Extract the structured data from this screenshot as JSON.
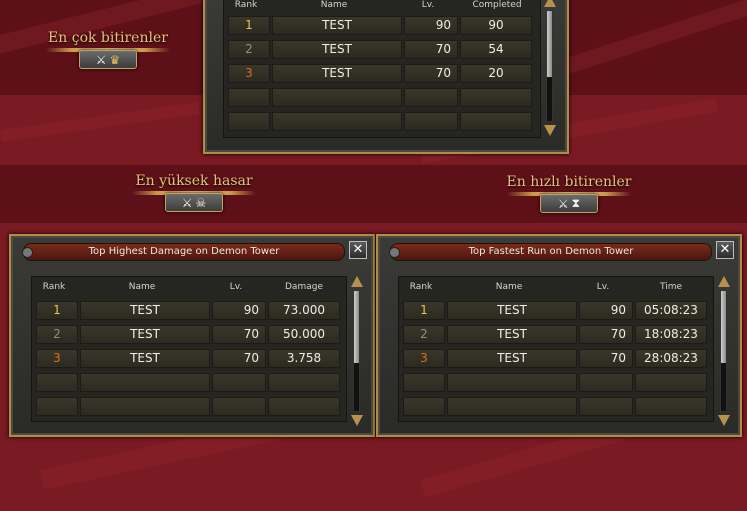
{
  "ribbons": {
    "most_completed": "En çok bitirenler",
    "highest_damage": "En yüksek hasar",
    "fastest": "En hızlı bitirenler"
  },
  "icons": {
    "swords": "crossed-swords-icon",
    "crown": "crown-icon",
    "skull": "skull-icon",
    "hourglass": "hourglass-icon"
  },
  "top_panel": {
    "headers": [
      "Rank",
      "Name",
      "Lv.",
      "Completed"
    ],
    "rows": [
      {
        "rank": "1",
        "name": "TEST",
        "lv": "90",
        "value": "90"
      },
      {
        "rank": "2",
        "name": "TEST",
        "lv": "70",
        "value": "54"
      },
      {
        "rank": "3",
        "name": "TEST",
        "lv": "70",
        "value": "20"
      },
      {
        "rank": "",
        "name": "",
        "lv": "",
        "value": ""
      },
      {
        "rank": "",
        "name": "",
        "lv": "",
        "value": ""
      }
    ]
  },
  "damage_panel": {
    "title": "Top Highest Damage on Demon Tower",
    "close": "✕",
    "headers": [
      "Rank",
      "Name",
      "Lv.",
      "Damage"
    ],
    "rows": [
      {
        "rank": "1",
        "name": "TEST",
        "lv": "90",
        "value": "73.000"
      },
      {
        "rank": "2",
        "name": "TEST",
        "lv": "70",
        "value": "50.000"
      },
      {
        "rank": "3",
        "name": "TEST",
        "lv": "70",
        "value": "3.758"
      },
      {
        "rank": "",
        "name": "",
        "lv": "",
        "value": ""
      },
      {
        "rank": "",
        "name": "",
        "lv": "",
        "value": ""
      }
    ]
  },
  "fastest_panel": {
    "title": "Top Fastest Run on Demon Tower",
    "close": "✕",
    "headers": [
      "Rank",
      "Name",
      "Lv.",
      "Time"
    ],
    "rows": [
      {
        "rank": "1",
        "name": "TEST",
        "lv": "90",
        "value": "05:08:23"
      },
      {
        "rank": "2",
        "name": "TEST",
        "lv": "70",
        "value": "18:08:23"
      },
      {
        "rank": "3",
        "name": "TEST",
        "lv": "70",
        "value": "28:08:23"
      },
      {
        "rank": "",
        "name": "",
        "lv": "",
        "value": ""
      },
      {
        "rank": "",
        "name": "",
        "lv": "",
        "value": ""
      }
    ]
  },
  "colors": {
    "rank1": "#e8c15a",
    "rank2": "#8f8f86",
    "rank3": "#e06a2c",
    "gold": "#b08d45"
  }
}
